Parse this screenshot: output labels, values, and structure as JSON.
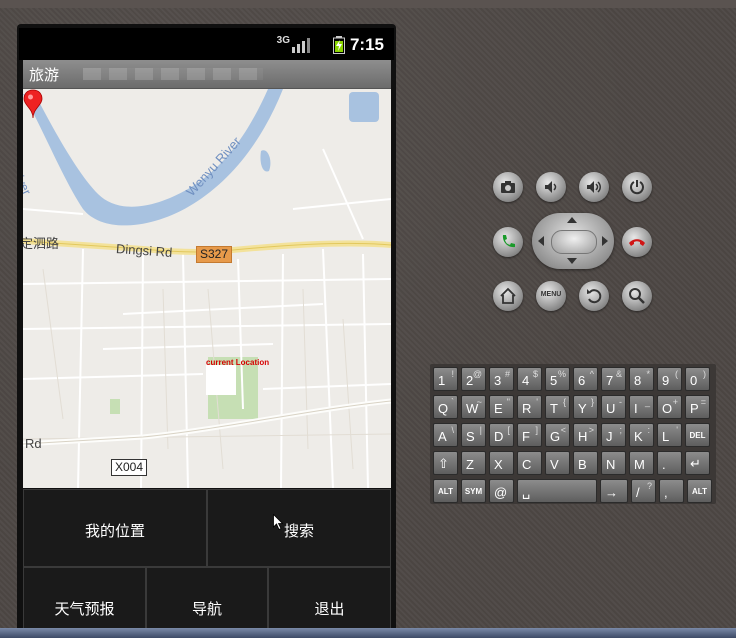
{
  "status": {
    "network": "3G",
    "time": "7:15"
  },
  "app": {
    "title": "旅游"
  },
  "map": {
    "labels": {
      "river_1": "Wenyu River",
      "river_2": "Wenyu River",
      "road_cn": "定泗路",
      "road_en": "Dingsi Rd",
      "road_left": "Rd",
      "badge_s327": "S327",
      "badge_x004": "X004"
    },
    "current_location_label": "current Location"
  },
  "menu": {
    "my_location": "我的位置",
    "search": "搜索",
    "weather": "天气预报",
    "navigation": "导航",
    "exit": "退出"
  },
  "keyboard": {
    "rows": [
      [
        {
          "k": "1",
          "a": "!"
        },
        {
          "k": "2",
          "a": "@"
        },
        {
          "k": "3",
          "a": "#"
        },
        {
          "k": "4",
          "a": "$"
        },
        {
          "k": "5",
          "a": "%"
        },
        {
          "k": "6",
          "a": "^"
        },
        {
          "k": "7",
          "a": "&"
        },
        {
          "k": "8",
          "a": "*"
        },
        {
          "k": "9",
          "a": "("
        },
        {
          "k": "0",
          "a": ")"
        }
      ],
      [
        {
          "k": "Q",
          "a": "`"
        },
        {
          "k": "W",
          "a": "~"
        },
        {
          "k": "E",
          "a": "\""
        },
        {
          "k": "R",
          "a": "'"
        },
        {
          "k": "T",
          "a": "{"
        },
        {
          "k": "Y",
          "a": "}"
        },
        {
          "k": "U",
          "a": "-"
        },
        {
          "k": "I",
          "a": "_"
        },
        {
          "k": "O",
          "a": "+"
        },
        {
          "k": "P",
          "a": "="
        }
      ],
      [
        {
          "k": "A",
          "a": "\\"
        },
        {
          "k": "S",
          "a": "|"
        },
        {
          "k": "D",
          "a": "["
        },
        {
          "k": "F",
          "a": "]"
        },
        {
          "k": "G",
          "a": "<"
        },
        {
          "k": "H",
          "a": ">"
        },
        {
          "k": "J",
          "a": ";"
        },
        {
          "k": "K",
          "a": ":"
        },
        {
          "k": "L",
          "a": "'"
        },
        {
          "k": "DEL",
          "a": ""
        }
      ],
      [
        {
          "k": "⇧",
          "a": ""
        },
        {
          "k": "Z",
          "a": ""
        },
        {
          "k": "X",
          "a": ""
        },
        {
          "k": "C",
          "a": ""
        },
        {
          "k": "V",
          "a": ""
        },
        {
          "k": "B",
          "a": ""
        },
        {
          "k": "N",
          "a": ""
        },
        {
          "k": "M",
          "a": ""
        },
        {
          "k": ".",
          "a": ""
        },
        {
          "k": "↵",
          "a": ""
        }
      ],
      [
        {
          "k": "ALT",
          "a": ""
        },
        {
          "k": "SYM",
          "a": ""
        },
        {
          "k": "@",
          "a": ""
        },
        {
          "k": "␣",
          "a": ""
        },
        {
          "k": "→",
          "a": ""
        },
        {
          "k": "/",
          "a": "?"
        },
        {
          "k": ",",
          "a": ""
        },
        {
          "k": "ALT",
          "a": ""
        }
      ]
    ]
  },
  "controls": {
    "menu_label": "MENU"
  }
}
